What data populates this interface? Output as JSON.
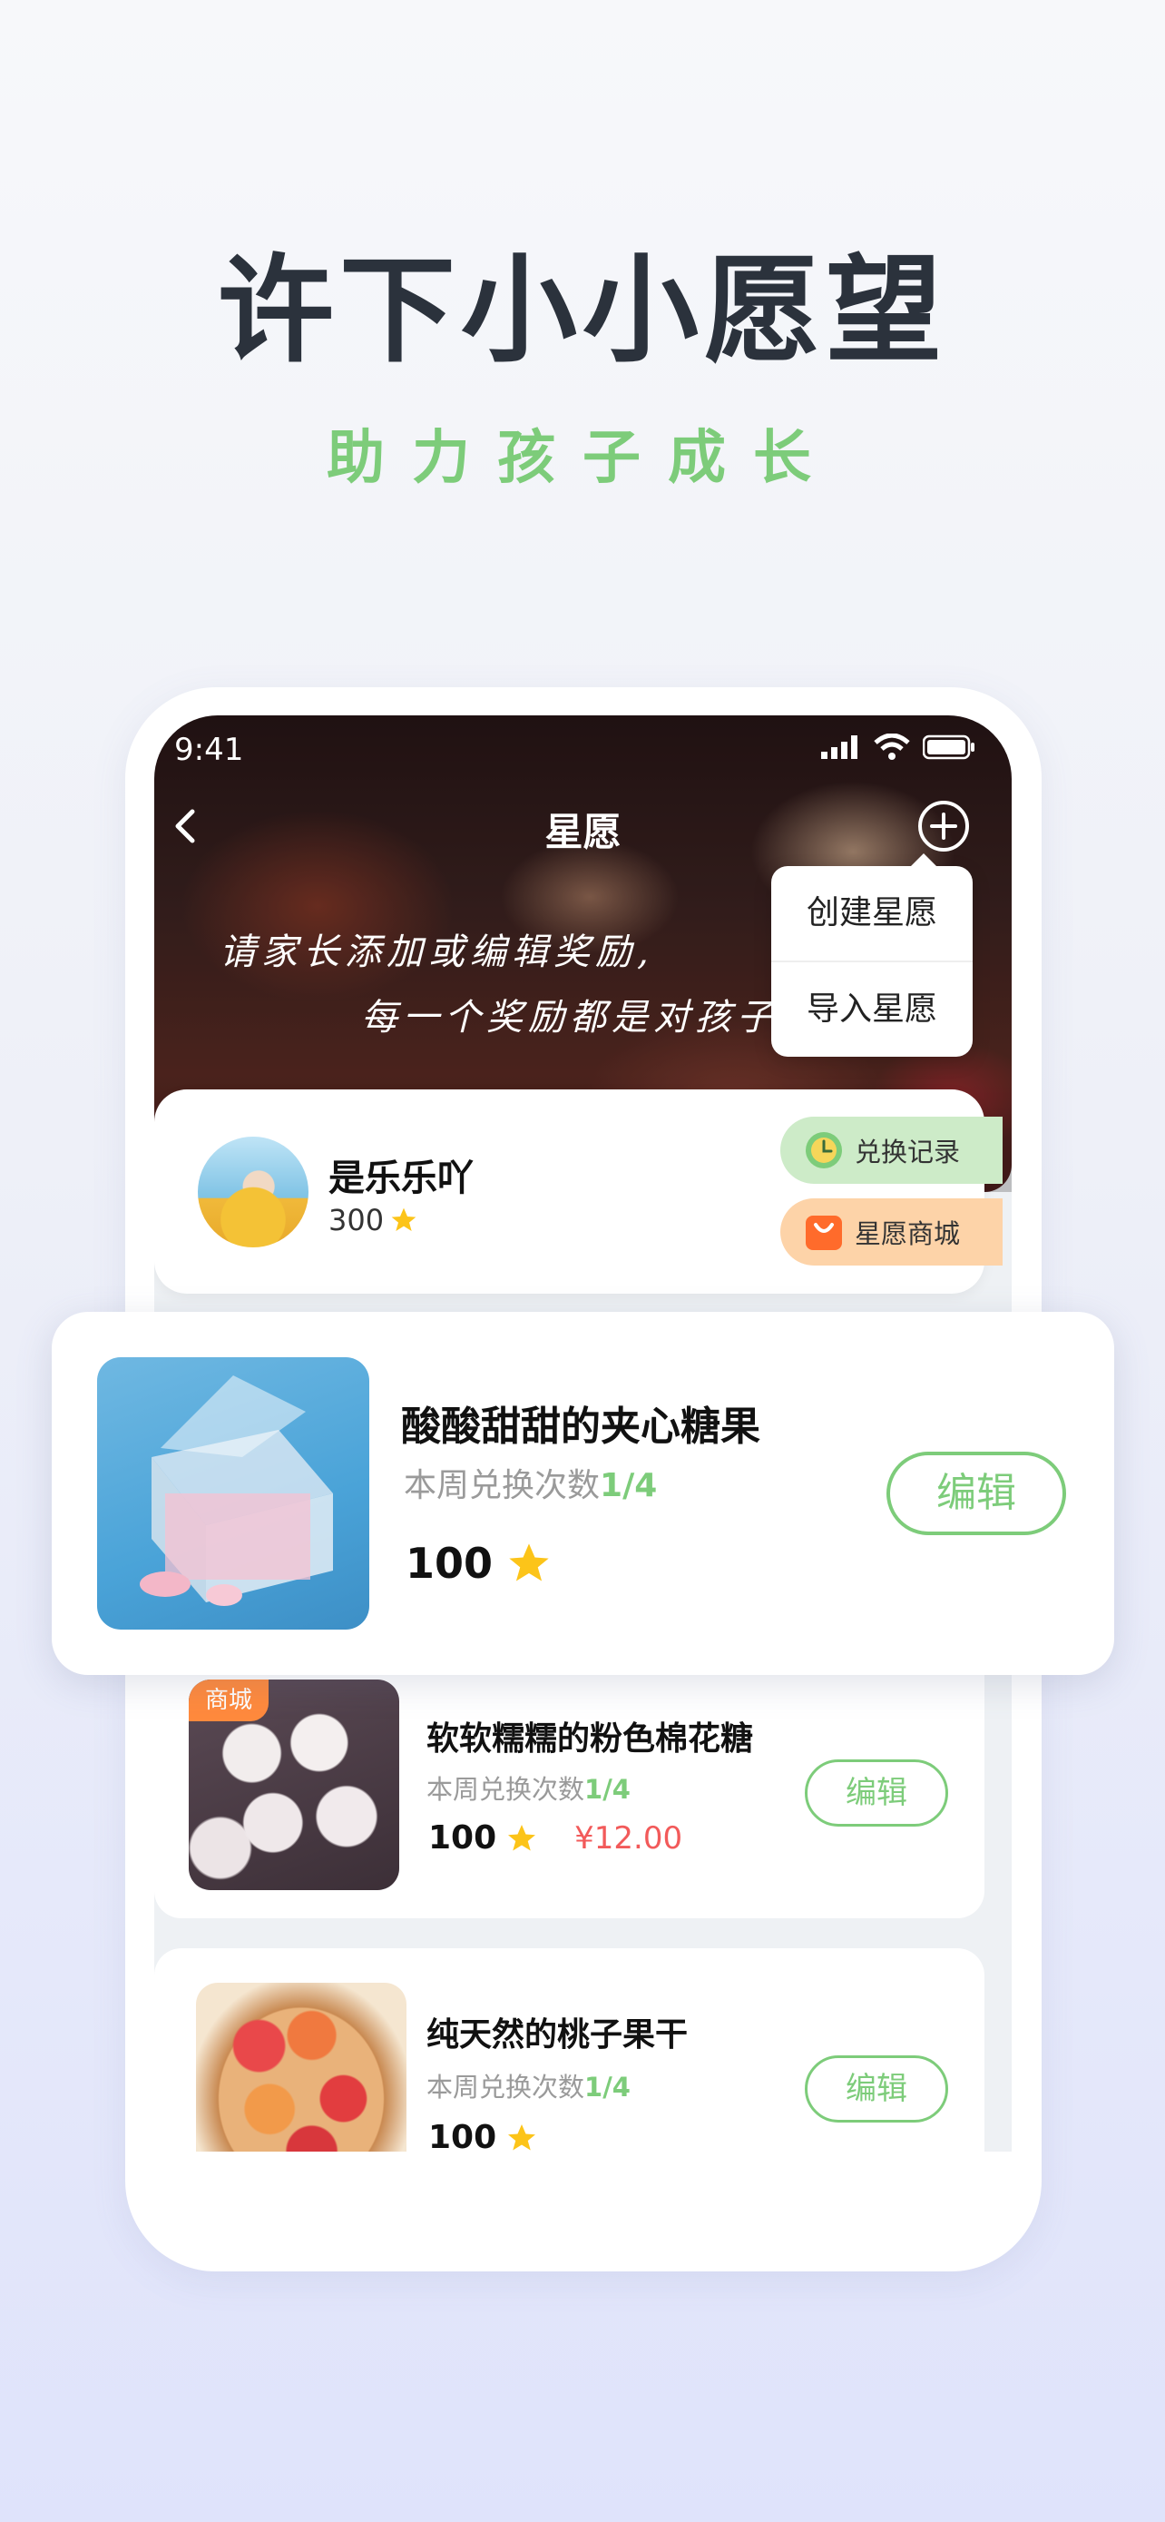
{
  "headline": "许下小小愿望",
  "subline": "助力孩子成长",
  "status": {
    "time": "9:41"
  },
  "nav": {
    "title": "星愿"
  },
  "hero": {
    "line1": "请家长添加或编辑奖励,",
    "line2": "每一个奖励都是对孩子"
  },
  "dropdown": {
    "items": [
      "创建星愿",
      "导入星愿"
    ]
  },
  "profile": {
    "name": "是乐乐吖",
    "stars": "300",
    "redeem_label": "兑换记录",
    "shop_label": "星愿商城"
  },
  "featured": {
    "title": "酸酸甜甜的夹心糖果",
    "sub_prefix": "本周兑换次数",
    "sub_count": "1/4",
    "price": "100",
    "edit_label": "编辑"
  },
  "items": [
    {
      "tag": "商城",
      "title": "软软糯糯的粉色棉花糖",
      "sub_prefix": "本周兑换次数",
      "sub_count": "1/4",
      "price": "100",
      "money": "¥12.00",
      "edit_label": "编辑"
    },
    {
      "title": "纯天然的桃子果干",
      "sub_prefix": "本周兑换次数",
      "sub_count": "1/4",
      "price": "100",
      "edit_label": "编辑"
    }
  ],
  "colors": {
    "accent_green": "#7dcc7a",
    "price_red": "#f25a5a",
    "shop_orange": "#ff8a3d"
  },
  "tabs": [
    "home-icon",
    "checklist-icon",
    "star-icon",
    "profile-icon"
  ]
}
